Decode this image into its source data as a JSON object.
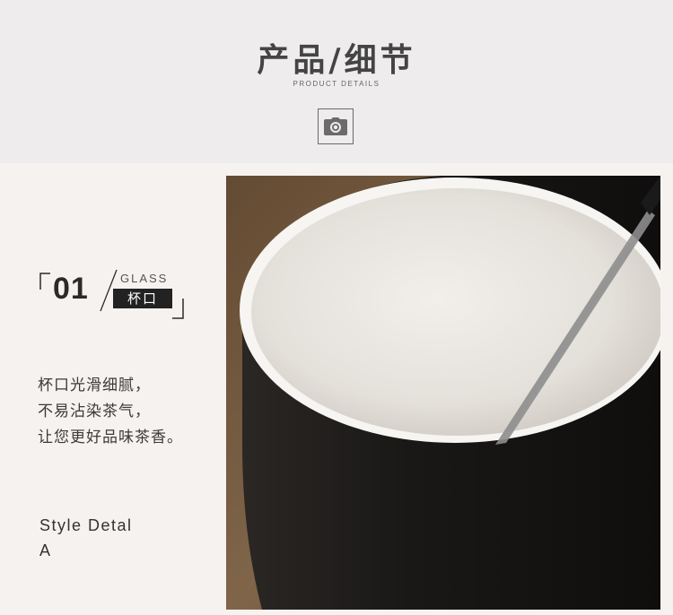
{
  "header": {
    "title": "产品/细节",
    "subtitle": "PRODUCT DETAILS",
    "icon": "camera-icon"
  },
  "detail": {
    "number": "01",
    "label_en": "GLASS",
    "label_cn": "杯口",
    "description": [
      "杯口光滑细腻，",
      "不易沾染茶气，",
      "让您更好品味茶香。"
    ],
    "style_line1": "Style Detal",
    "style_line2": "A"
  },
  "photo": {
    "subject": "black-white-ceramic-mug-with-spoon",
    "colors": {
      "mug_outer": "#1c1a19",
      "mug_inner": "#ebe8e3",
      "wood": "#8a6a4a"
    }
  },
  "colors": {
    "header_bg": "#eeecec",
    "content_bg": "#f6f2ef",
    "badge_bg": "#222222"
  }
}
